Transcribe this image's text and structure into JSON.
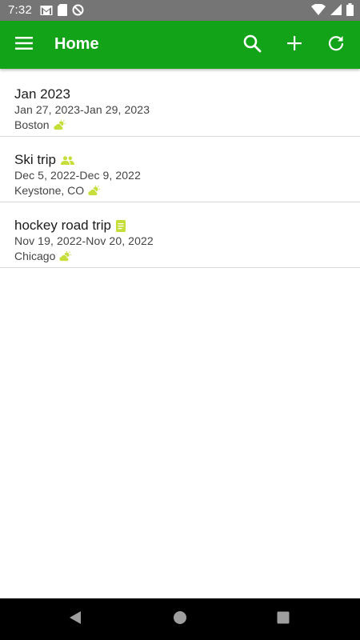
{
  "status_bar": {
    "time": "7:32",
    "left_icons": [
      "gmail-icon",
      "sd-card-icon",
      "blocked-icon"
    ],
    "right_icons": [
      "wifi-icon",
      "signal-icon",
      "battery-icon"
    ]
  },
  "app_bar": {
    "title": "Home",
    "color": "#12a318",
    "actions": [
      "search-icon",
      "add-icon",
      "refresh-icon"
    ]
  },
  "trips": [
    {
      "name": "Jan 2023",
      "dates": "Jan 27, 2023-Jan 29, 2023",
      "location": "Boston",
      "name_icon": "",
      "location_icon": "weather-icon"
    },
    {
      "name": "Ski trip",
      "dates": "Dec 5, 2022-Dec 9, 2022",
      "location": "Keystone, CO",
      "name_icon": "people-icon",
      "location_icon": "weather-icon"
    },
    {
      "name": "hockey road trip",
      "dates": "Nov 19, 2022-Nov 20, 2022",
      "location": "Chicago",
      "name_icon": "note-icon",
      "location_icon": "weather-icon"
    }
  ],
  "icon_color": "#c6dd3a",
  "nav_bar": {
    "buttons": [
      "back-icon",
      "home-icon",
      "recents-icon"
    ]
  }
}
